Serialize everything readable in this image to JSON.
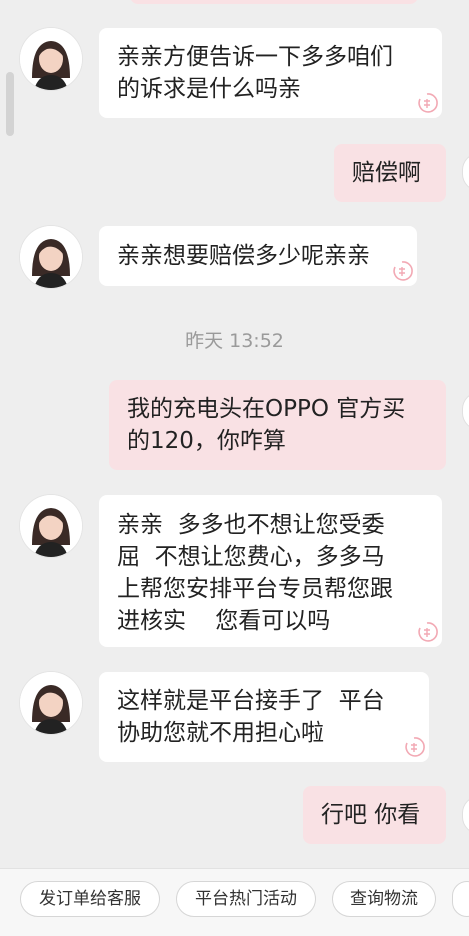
{
  "messages": [
    {
      "side": "left",
      "text": "亲亲方便告诉一下多多咱们\n的诉求是什么吗亲"
    },
    {
      "side": "right",
      "text": "赔偿啊"
    },
    {
      "side": "left",
      "text": "亲亲想要赔偿多少呢亲亲"
    },
    {
      "side": "right",
      "text": "我的充电头在OPPO 官方买\n的120，你咋算"
    },
    {
      "side": "left",
      "text": "亲亲  多多也不想让您受委\n屈  不想让您费心，多多马\n上帮您安排平台专员帮您跟\n进核实    您看可以吗"
    },
    {
      "side": "left",
      "text": "这样就是平台接手了  平台\n协助您就不用担心啦"
    },
    {
      "side": "right",
      "text": "行吧 你看"
    }
  ],
  "timestamp": "昨天 13:52",
  "quick_replies": [
    "发订单给客服",
    "平台热门活动",
    "查询物流"
  ],
  "colors": {
    "background": "#eeeeee",
    "agent_bubble": "#ffffff",
    "user_bubble": "#f9e1e4",
    "stamp": "#f2a9b4"
  },
  "icons": {
    "avatar": "agent-avatar-photo",
    "stamp": "pinduoduo-stamp-icon"
  }
}
